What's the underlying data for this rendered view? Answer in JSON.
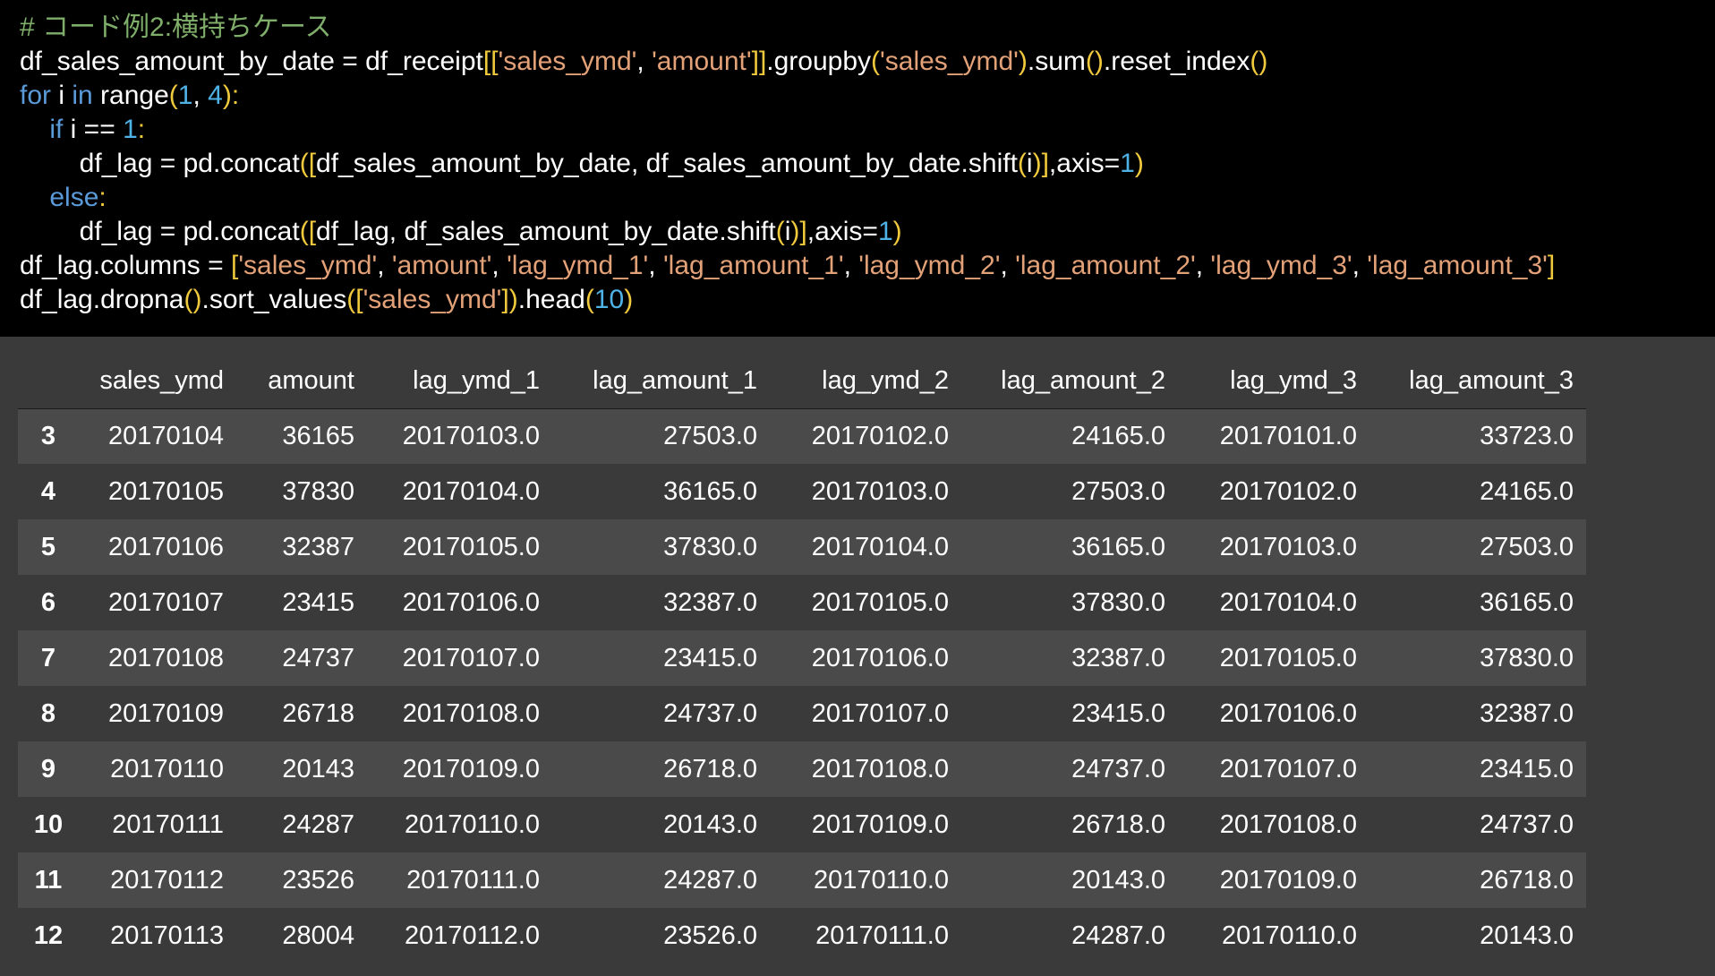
{
  "code": {
    "lines": [
      [
        {
          "t": "# コード例2:横持ちケース",
          "c": "comment"
        }
      ],
      [
        {
          "t": "df_sales_amount_by_date = df_receipt",
          "c": "default"
        },
        {
          "t": "[[",
          "c": "bracket"
        },
        {
          "t": "'sales_ymd'",
          "c": "string"
        },
        {
          "t": ", ",
          "c": "default"
        },
        {
          "t": "'amount'",
          "c": "string"
        },
        {
          "t": "]]",
          "c": "bracket"
        },
        {
          "t": ".groupby",
          "c": "default"
        },
        {
          "t": "(",
          "c": "bracket"
        },
        {
          "t": "'sales_ymd'",
          "c": "string"
        },
        {
          "t": ")",
          "c": "bracket"
        },
        {
          "t": ".sum",
          "c": "default"
        },
        {
          "t": "()",
          "c": "bracket"
        },
        {
          "t": ".reset_index",
          "c": "default"
        },
        {
          "t": "()",
          "c": "bracket"
        }
      ],
      [
        {
          "t": "for",
          "c": "keyword"
        },
        {
          "t": " i ",
          "c": "default"
        },
        {
          "t": "in",
          "c": "keyword"
        },
        {
          "t": " range",
          "c": "default"
        },
        {
          "t": "(",
          "c": "bracket"
        },
        {
          "t": "1",
          "c": "number"
        },
        {
          "t": ", ",
          "c": "default"
        },
        {
          "t": "4",
          "c": "number"
        },
        {
          "t": "):",
          "c": "bracket"
        }
      ],
      [
        {
          "t": "    ",
          "c": "default"
        },
        {
          "t": "if",
          "c": "keyword"
        },
        {
          "t": " i == ",
          "c": "default"
        },
        {
          "t": "1",
          "c": "number"
        },
        {
          "t": ":",
          "c": "bracket"
        }
      ],
      [
        {
          "t": "        df_lag = pd.concat",
          "c": "default"
        },
        {
          "t": "([",
          "c": "bracket"
        },
        {
          "t": "df_sales_amount_by_date, df_sales_amount_by_date.shift",
          "c": "default"
        },
        {
          "t": "(",
          "c": "bracket"
        },
        {
          "t": "i",
          "c": "default"
        },
        {
          "t": ")]",
          "c": "bracket"
        },
        {
          "t": ",axis=",
          "c": "default"
        },
        {
          "t": "1",
          "c": "number"
        },
        {
          "t": ")",
          "c": "bracket"
        }
      ],
      [
        {
          "t": "    ",
          "c": "default"
        },
        {
          "t": "else",
          "c": "keyword"
        },
        {
          "t": ":",
          "c": "bracket"
        }
      ],
      [
        {
          "t": "        df_lag = pd.concat",
          "c": "default"
        },
        {
          "t": "([",
          "c": "bracket"
        },
        {
          "t": "df_lag, df_sales_amount_by_date.shift",
          "c": "default"
        },
        {
          "t": "(",
          "c": "bracket"
        },
        {
          "t": "i",
          "c": "default"
        },
        {
          "t": ")]",
          "c": "bracket"
        },
        {
          "t": ",axis=",
          "c": "default"
        },
        {
          "t": "1",
          "c": "number"
        },
        {
          "t": ")",
          "c": "bracket"
        }
      ],
      [
        {
          "t": "df_lag.columns = ",
          "c": "default"
        },
        {
          "t": "[",
          "c": "bracket"
        },
        {
          "t": "'sales_ymd'",
          "c": "string"
        },
        {
          "t": ", ",
          "c": "default"
        },
        {
          "t": "'amount'",
          "c": "string"
        },
        {
          "t": ", ",
          "c": "default"
        },
        {
          "t": "'lag_ymd_1'",
          "c": "string"
        },
        {
          "t": ", ",
          "c": "default"
        },
        {
          "t": "'lag_amount_1'",
          "c": "string"
        },
        {
          "t": ", ",
          "c": "default"
        },
        {
          "t": "'lag_ymd_2'",
          "c": "string"
        },
        {
          "t": ", ",
          "c": "default"
        },
        {
          "t": "'lag_amount_2'",
          "c": "string"
        },
        {
          "t": ", ",
          "c": "default"
        },
        {
          "t": "'lag_ymd_3'",
          "c": "string"
        },
        {
          "t": ", ",
          "c": "default"
        },
        {
          "t": "'lag_amount_3'",
          "c": "string"
        },
        {
          "t": "]",
          "c": "bracket"
        }
      ],
      [
        {
          "t": "df_lag.dropna",
          "c": "default"
        },
        {
          "t": "()",
          "c": "bracket"
        },
        {
          "t": ".sort_values",
          "c": "default"
        },
        {
          "t": "([",
          "c": "bracket"
        },
        {
          "t": "'sales_ymd'",
          "c": "string"
        },
        {
          "t": "])",
          "c": "bracket"
        },
        {
          "t": ".head",
          "c": "default"
        },
        {
          "t": "(",
          "c": "bracket"
        },
        {
          "t": "10",
          "c": "number"
        },
        {
          "t": ")",
          "c": "bracket"
        }
      ]
    ]
  },
  "colors": {
    "comment": "#7fae6a",
    "keyword": "#5a9ad8",
    "bracket": "#f0c93c",
    "string": "#e3a178",
    "number": "#4fb2e6",
    "code_background": "#000000",
    "output_background": "#3a3a3a",
    "row_stripe": "#4a4a4a"
  },
  "table": {
    "columns": [
      "",
      "sales_ymd",
      "amount",
      "lag_ymd_1",
      "lag_amount_1",
      "lag_ymd_2",
      "lag_amount_2",
      "lag_ymd_3",
      "lag_amount_3"
    ],
    "rows": [
      [
        "3",
        "20170104",
        "36165",
        "20170103.0",
        "27503.0",
        "20170102.0",
        "24165.0",
        "20170101.0",
        "33723.0"
      ],
      [
        "4",
        "20170105",
        "37830",
        "20170104.0",
        "36165.0",
        "20170103.0",
        "27503.0",
        "20170102.0",
        "24165.0"
      ],
      [
        "5",
        "20170106",
        "32387",
        "20170105.0",
        "37830.0",
        "20170104.0",
        "36165.0",
        "20170103.0",
        "27503.0"
      ],
      [
        "6",
        "20170107",
        "23415",
        "20170106.0",
        "32387.0",
        "20170105.0",
        "37830.0",
        "20170104.0",
        "36165.0"
      ],
      [
        "7",
        "20170108",
        "24737",
        "20170107.0",
        "23415.0",
        "20170106.0",
        "32387.0",
        "20170105.0",
        "37830.0"
      ],
      [
        "8",
        "20170109",
        "26718",
        "20170108.0",
        "24737.0",
        "20170107.0",
        "23415.0",
        "20170106.0",
        "32387.0"
      ],
      [
        "9",
        "20170110",
        "20143",
        "20170109.0",
        "26718.0",
        "20170108.0",
        "24737.0",
        "20170107.0",
        "23415.0"
      ],
      [
        "10",
        "20170111",
        "24287",
        "20170110.0",
        "20143.0",
        "20170109.0",
        "26718.0",
        "20170108.0",
        "24737.0"
      ],
      [
        "11",
        "20170112",
        "23526",
        "20170111.0",
        "24287.0",
        "20170110.0",
        "20143.0",
        "20170109.0",
        "26718.0"
      ],
      [
        "12",
        "20170113",
        "28004",
        "20170112.0",
        "23526.0",
        "20170111.0",
        "24287.0",
        "20170110.0",
        "20143.0"
      ]
    ]
  }
}
